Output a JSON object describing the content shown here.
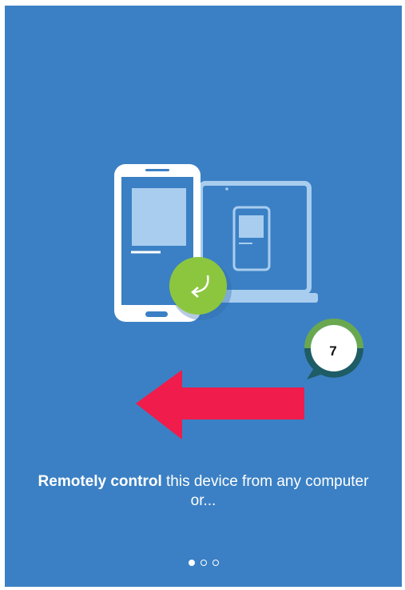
{
  "caption": {
    "bold": "Remotely control",
    "rest": " this device from any computer or..."
  },
  "pager": {
    "total": 3,
    "active_index": 0
  },
  "annotation": {
    "step_number": "7"
  },
  "colors": {
    "background": "#3b80c4",
    "accent_green": "#8cc63f",
    "arrow_red": "#f01c4b",
    "badge_ring_top": "#6aa84f",
    "badge_ring_bottom": "#1e5c66"
  }
}
